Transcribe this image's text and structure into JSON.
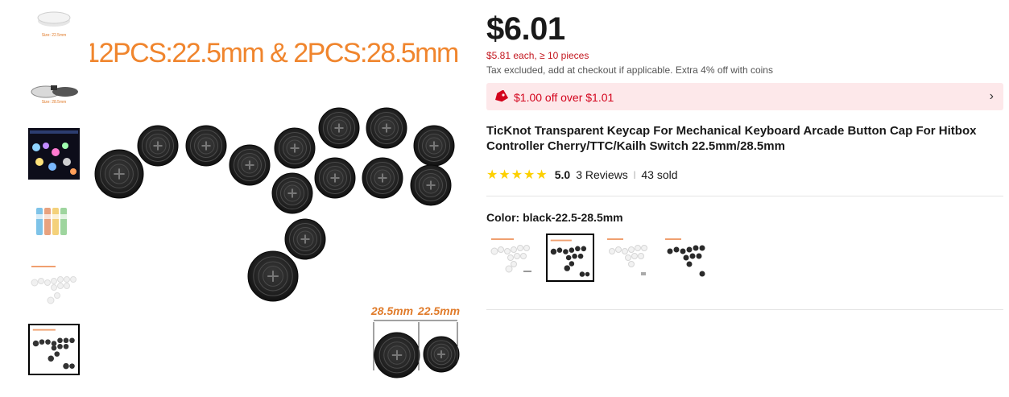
{
  "gallery": {
    "thumbnails": [
      {
        "name": "thumb-1",
        "caption": "Size: 22.5mm"
      },
      {
        "name": "thumb-2",
        "caption": "Size: 28.5mm"
      },
      {
        "name": "thumb-3",
        "caption": ""
      },
      {
        "name": "thumb-4",
        "caption": ""
      },
      {
        "name": "thumb-5",
        "caption": ""
      },
      {
        "name": "thumb-6",
        "caption": ""
      }
    ],
    "main_image": {
      "headline": "12PCS:22.5mm & 2PCS:28.5mm",
      "size_large": "28.5mm",
      "size_small": "22.5mm"
    }
  },
  "product": {
    "price": "$6.01",
    "bulk_price": "$5.81 each, ≥ 10 pieces",
    "tax_note": "Tax excluded, add at checkout if applicable. Extra 4% off with coins",
    "coupon": "$1.00 off over $1.01",
    "title": "TicKnot Transparent Keycap For Mechanical Keyboard Arcade Button Cap For Hitbox Controller Cherry/TTC/Kailh Switch 22.5mm/28.5mm",
    "rating": {
      "stars": "★★★★★",
      "score": "5.0",
      "reviews": "3 Reviews",
      "sold": "43 sold"
    },
    "color_label": "Color: black-22.5-28.5mm",
    "swatches": [
      "white-22.5-28.5mm",
      "black-22.5-28.5mm",
      "white-22.5mm",
      "black-22.5mm"
    ],
    "selected_swatch": 1
  },
  "colors": {
    "accent": "#d3031c",
    "star": "#fdd000",
    "coupon_bg": "#fde8ea",
    "headline_orange": "#f0852d"
  }
}
